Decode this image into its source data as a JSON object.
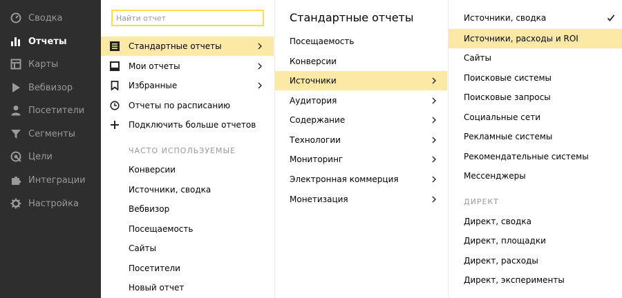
{
  "sidebar": {
    "items": [
      {
        "label": "Сводка",
        "icon": "dashboard-icon"
      },
      {
        "label": "Отчеты",
        "icon": "reports-bar-icon",
        "active": true
      },
      {
        "label": "Карты",
        "icon": "map-icon"
      },
      {
        "label": "Вебвизор",
        "icon": "play-icon"
      },
      {
        "label": "Посетители",
        "icon": "user-icon"
      },
      {
        "label": "Сегменты",
        "icon": "filter-icon"
      },
      {
        "label": "Цели",
        "icon": "target-icon"
      },
      {
        "label": "Интеграции",
        "icon": "puzzle-icon"
      },
      {
        "label": "Настройка",
        "icon": "gear-icon"
      }
    ]
  },
  "reports_menu": {
    "search_placeholder": "Найти отчет",
    "items": [
      {
        "label": "Стандартные отчеты",
        "icon": "document-icon",
        "has_submenu": true,
        "highlighted": true
      },
      {
        "label": "Мои отчеты",
        "icon": "inbox-icon",
        "has_submenu": true
      },
      {
        "label": "Избранные",
        "icon": "bookmark-icon",
        "has_submenu": true
      },
      {
        "label": "Отчеты по расписанию",
        "icon": "clock-icon"
      },
      {
        "label": "Подключить больше отчетов",
        "icon": "plus-icon"
      }
    ],
    "frequent_heading": "ЧАСТО ИСПОЛЬЗУЕМЫЕ",
    "frequent": [
      "Конверсии",
      "Источники, сводка",
      "Вебвизор",
      "Посещаемость",
      "Сайты",
      "Посетители",
      "Новый отчет"
    ]
  },
  "standard_reports": {
    "title": "Стандартные отчеты",
    "items": [
      {
        "label": "Посещаемость",
        "has_submenu": false
      },
      {
        "label": "Конверсии",
        "has_submenu": false
      },
      {
        "label": "Источники",
        "has_submenu": true,
        "highlighted": true
      },
      {
        "label": "Аудитория",
        "has_submenu": true
      },
      {
        "label": "Содержание",
        "has_submenu": true
      },
      {
        "label": "Технологии",
        "has_submenu": true
      },
      {
        "label": "Мониторинг",
        "has_submenu": true
      },
      {
        "label": "Электронная коммерция",
        "has_submenu": true
      },
      {
        "label": "Монетизация",
        "has_submenu": true
      }
    ]
  },
  "sources": {
    "items": [
      {
        "label": "Источники, сводка",
        "checked": true
      },
      {
        "label": "Источники, расходы и ROI",
        "highlighted": true
      },
      {
        "label": "Сайты"
      },
      {
        "label": "Поисковые системы"
      },
      {
        "label": "Поисковые запросы"
      },
      {
        "label": "Социальные сети"
      },
      {
        "label": "Рекламные системы"
      },
      {
        "label": "Рекомендательные системы"
      },
      {
        "label": "Мессенджеры"
      }
    ],
    "direct_heading": "ДИРЕКТ",
    "direct": [
      "Директ, сводка",
      "Директ, площадки",
      "Директ, расходы",
      "Директ, эксперименты"
    ]
  },
  "colors": {
    "sidebar_bg": "#2e2e2e",
    "highlight": "#fce9a5",
    "search_border": "#ffdb4d"
  }
}
